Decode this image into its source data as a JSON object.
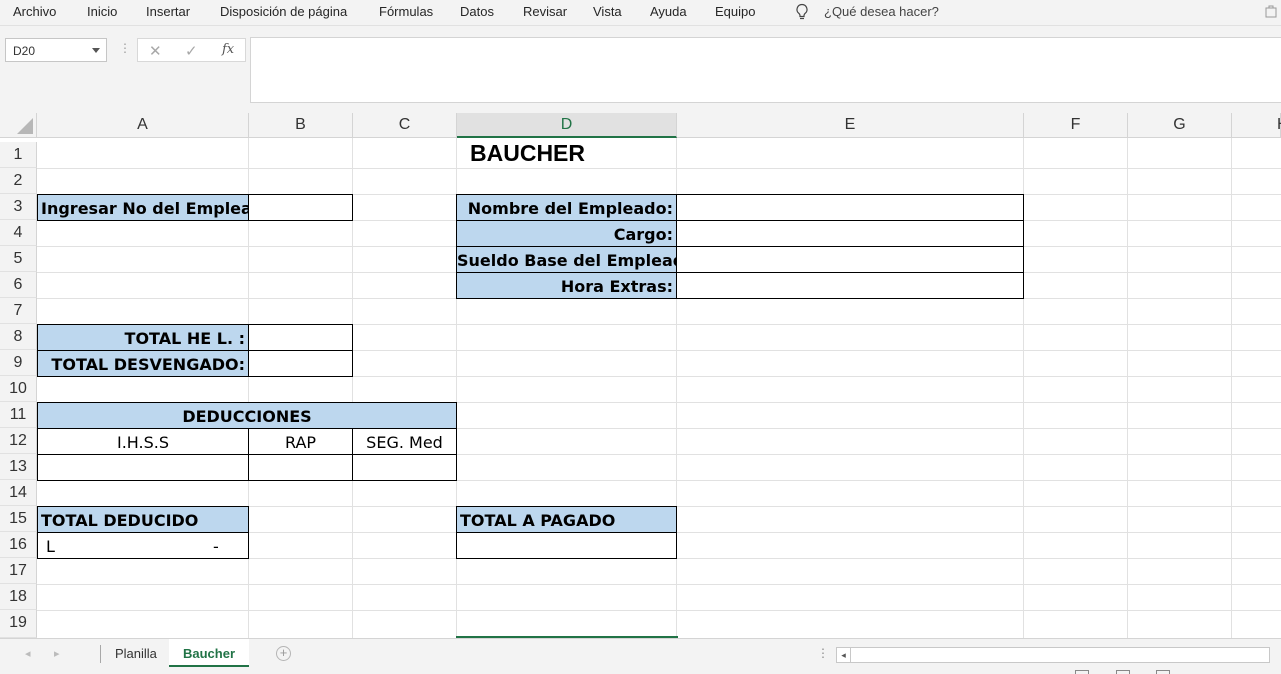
{
  "menu": [
    "Archivo",
    "Inicio",
    "Insertar",
    "Disposición de página",
    "Fórmulas",
    "Datos",
    "Revisar",
    "Vista",
    "Ayuda",
    "Equipo"
  ],
  "tell_me": "¿Qué desea hacer?",
  "formula_bar": {
    "name_box": "D20",
    "cancel_glyph": "✕",
    "enter_glyph": "✓",
    "fx_label": "fx",
    "formula": ""
  },
  "columns": [
    "A",
    "B",
    "C",
    "D",
    "E",
    "F",
    "G",
    "H"
  ],
  "active_column": "D",
  "rows": [
    "1",
    "2",
    "3",
    "4",
    "5",
    "6",
    "7",
    "8",
    "9",
    "10",
    "11",
    "12",
    "13",
    "14",
    "15",
    "16",
    "17",
    "18",
    "19"
  ],
  "sheet": {
    "title": "BAUCHER",
    "ingresar_label": "Ingresar No del Empleado:",
    "nombre_label": "Nombre del Empleado:",
    "cargo_label": "Cargo:",
    "sueldo_label": "Sueldo Base del Empleado:",
    "hora_label": "Hora Extras:",
    "total_he_label": "TOTAL HE L. :",
    "total_desvengado_label": "TOTAL DESVENGADO:",
    "deducciones_label": "DEDUCCIONES",
    "ihss_label": "I.H.S.S",
    "rap_label": "RAP",
    "segmed_label": "SEG. Med",
    "total_deducido_label": "TOTAL DEDUCIDO",
    "total_deducido_currency": "L",
    "total_deducido_value": "-",
    "total_pagado_label": "TOTAL A PAGADO"
  },
  "tabs": [
    {
      "label": "Planilla",
      "active": false
    },
    {
      "label": "Baucher",
      "active": true
    }
  ],
  "add_sheet_glyph": "+",
  "colors": {
    "accent": "#217346",
    "label_fill": "#bdd7ee"
  }
}
